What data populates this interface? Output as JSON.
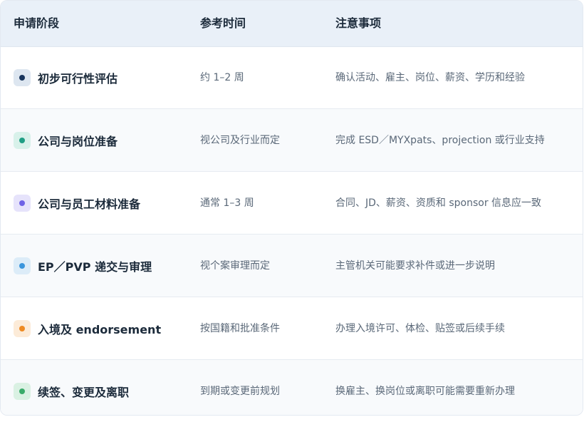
{
  "header": {
    "stage": "申请阶段",
    "time": "参考时间",
    "notes": "注意事项"
  },
  "rows": [
    {
      "stage": "初步可行性评估",
      "time": "约 1–2 周",
      "notes": "确认活动、雇主、岗位、薪资、学历和经验",
      "dot_color": "#17345c",
      "dot_bg": "#dde6f0"
    },
    {
      "stage": "公司与岗位准备",
      "time": "视公司及行业而定",
      "notes": "完成 ESD／MYXpats、projection 或行业支持",
      "dot_color": "#1f9e84",
      "dot_bg": "#d8f1ea"
    },
    {
      "stage": "公司与员工材料准备",
      "time": "通常 1–3 周",
      "notes": "合同、JD、薪资、资质和 sponsor 信息应一致",
      "dot_color": "#6f63e6",
      "dot_bg": "#e6e3fb"
    },
    {
      "stage": "EP／PVP 递交与审理",
      "time": "视个案审理而定",
      "notes": "主管机关可能要求补件或进一步说明",
      "dot_color": "#3a95dc",
      "dot_bg": "#dcecf8"
    },
    {
      "stage": "入境及 endorsement",
      "time": "按国籍和批准条件",
      "notes": "办理入境许可、体检、贴签或后续手续",
      "dot_color": "#ee8a22",
      "dot_bg": "#fcebd8"
    },
    {
      "stage": "续签、变更及离职",
      "time": "到期或变更前规划",
      "notes": "换雇主、换岗位或离职可能需要重新办理",
      "dot_color": "#3aab6a",
      "dot_bg": "#daf1e3"
    }
  ]
}
